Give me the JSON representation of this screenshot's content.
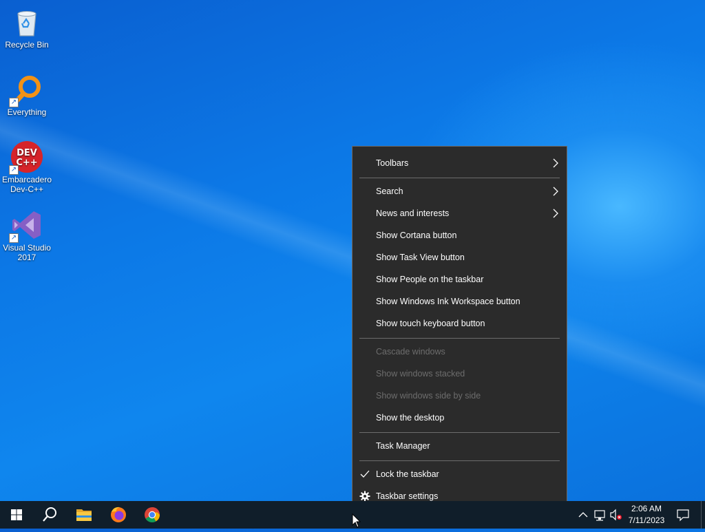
{
  "desktop": {
    "icons": [
      {
        "label": "Recycle Bin",
        "icon": "recycle-bin-icon"
      },
      {
        "label": "Everything",
        "icon": "everything-search-icon"
      },
      {
        "label": "Embarcadero Dev-C++",
        "icon": "devcpp-icon"
      },
      {
        "label": "Visual Studio 2017",
        "icon": "visual-studio-icon"
      }
    ]
  },
  "context_menu": {
    "items": [
      {
        "label": "Toolbars",
        "submenu": true,
        "enabled": true
      },
      {
        "label": "Search",
        "submenu": true,
        "enabled": true
      },
      {
        "label": "News and interests",
        "submenu": true,
        "enabled": true
      },
      {
        "label": "Show Cortana button",
        "enabled": true
      },
      {
        "label": "Show Task View button",
        "enabled": true
      },
      {
        "label": "Show People on the taskbar",
        "enabled": true
      },
      {
        "label": "Show Windows Ink Workspace button",
        "enabled": true
      },
      {
        "label": "Show touch keyboard button",
        "enabled": true
      },
      {
        "label": "Cascade windows",
        "enabled": false
      },
      {
        "label": "Show windows stacked",
        "enabled": false
      },
      {
        "label": "Show windows side by side",
        "enabled": false
      },
      {
        "label": "Show the desktop",
        "enabled": true
      },
      {
        "label": "Task Manager",
        "enabled": true
      },
      {
        "label": "Lock the taskbar",
        "checked": true,
        "enabled": true
      },
      {
        "label": "Taskbar settings",
        "icon": "gear-icon",
        "enabled": true
      }
    ]
  },
  "taskbar": {
    "buttons": [
      "start-icon",
      "search-icon",
      "file-explorer-icon",
      "firefox-icon",
      "chrome-icon"
    ],
    "tray": {
      "icons": [
        "chevron-up-icon",
        "network-icon",
        "volume-muted-icon",
        "notification-icon"
      ],
      "time": "2:06 AM",
      "date": "7/11/2023"
    },
    "background": "#101e2a"
  },
  "colors": {
    "menu_bg": "#2b2b2b",
    "menu_disabled_text": "#6d6d6d",
    "desktop_blue": "#0c78e6"
  }
}
